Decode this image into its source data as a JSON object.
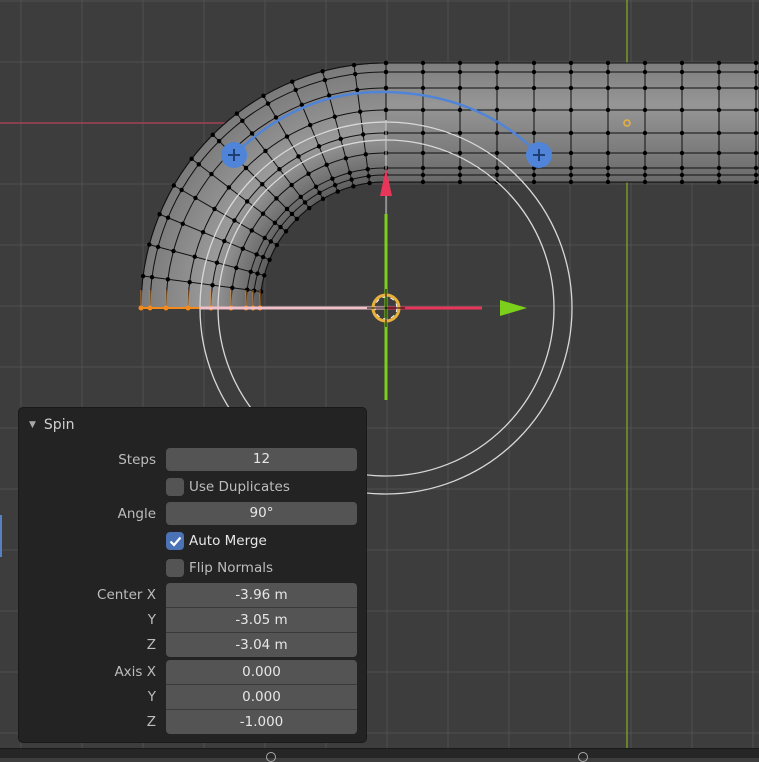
{
  "viewport": {
    "colors": {
      "background": "#3d3d3d",
      "grid": "#505050",
      "x_axis_line": "#a04454",
      "y_axis_line": "#7a9a2a",
      "mesh_face": "#8a8a8a",
      "mesh_edge": "#101010",
      "selected_vertex": "#f28a1c",
      "spin_arc": "#4f84d8",
      "gizmo_red": "#e8365a",
      "gizmo_green": "#7ccf1a",
      "cursor_ring": "#e8b13c"
    },
    "gizmo": {
      "arc_handles": [
        "arc-handle-left",
        "arc-handle-right"
      ],
      "arrows": [
        "arrow-up",
        "arrow-right"
      ]
    }
  },
  "panel": {
    "title": "Spin",
    "collapse_icon": "triangle-down",
    "steps": {
      "label": "Steps",
      "value": "12"
    },
    "use_duplicates": {
      "label": "Use Duplicates",
      "checked": false
    },
    "angle": {
      "label": "Angle",
      "value": "90°"
    },
    "auto_merge": {
      "label": "Auto Merge",
      "checked": true
    },
    "flip_normals": {
      "label": "Flip Normals",
      "checked": false
    },
    "center": {
      "x": {
        "label": "Center X",
        "value": "-3.96 m"
      },
      "y": {
        "label": "Y",
        "value": "-3.05 m"
      },
      "z": {
        "label": "Z",
        "value": "-3.04 m"
      }
    },
    "axis": {
      "x": {
        "label": "Axis X",
        "value": "0.000"
      },
      "y": {
        "label": "Y",
        "value": "0.000"
      },
      "z": {
        "label": "Z",
        "value": "-1.000"
      }
    }
  }
}
